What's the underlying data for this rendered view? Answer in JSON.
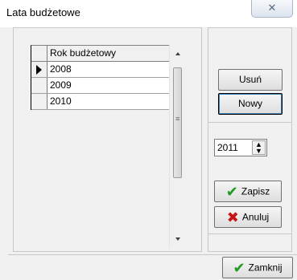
{
  "window": {
    "title": "Lata budżetowe",
    "close_glyph": "✕"
  },
  "grid": {
    "column_header": "Rok budżetowy",
    "rows": [
      "2008",
      "2009",
      "2010"
    ],
    "selected_index": 0
  },
  "buttons": {
    "delete_label": "Usuń",
    "new_label": "Nowy",
    "save_label": "Zapisz",
    "cancel_label": "Anuluj",
    "close_label": "Zamknij"
  },
  "year_spin": {
    "value": "2011"
  },
  "icons": {
    "save": "check-icon",
    "cancel": "x-icon",
    "close": "check-icon"
  },
  "colors": {
    "check_green": "#1e9a1e",
    "cancel_red": "#c81414"
  }
}
